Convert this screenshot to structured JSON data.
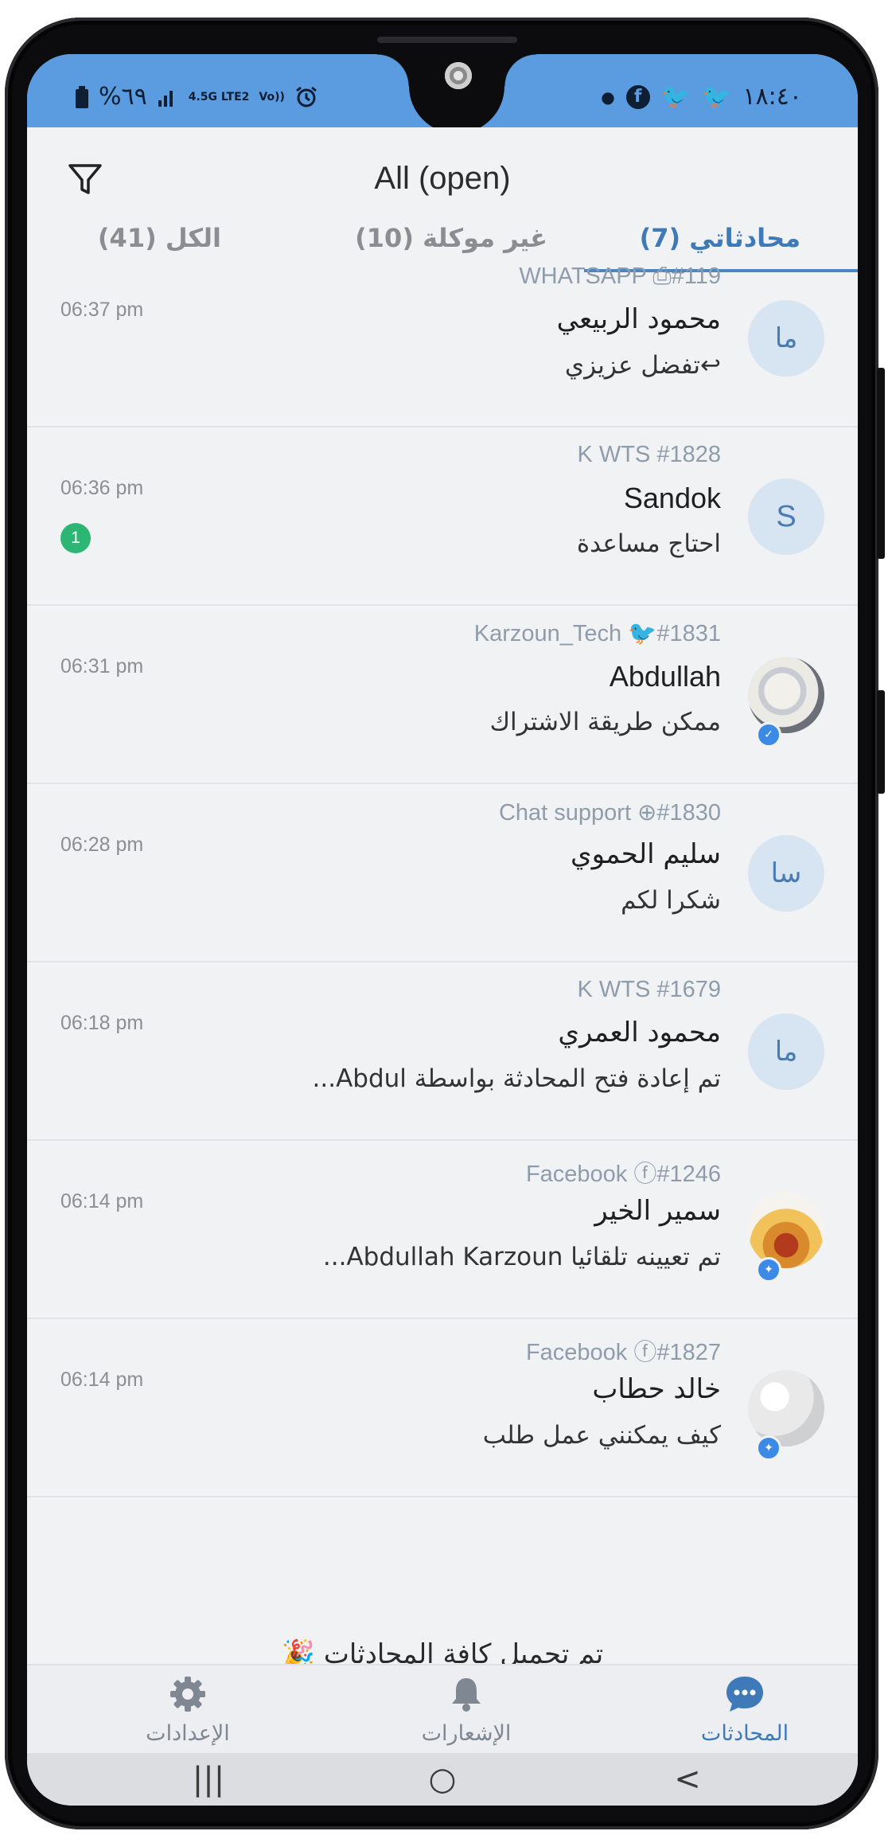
{
  "status_bar": {
    "battery_text": "%٦٩",
    "network_text": "4.5G LTE2",
    "volte": "Vo))",
    "time": "١٨:٤٠",
    "icons": [
      "battery-icon",
      "signal-icon",
      "alarm-icon",
      "dot-icon",
      "facebook-icon",
      "twitter-icon",
      "twitter-icon"
    ]
  },
  "header": {
    "title": "All (open)",
    "filter_icon": "filter-icon"
  },
  "tabs": [
    {
      "label": "محادثاتي (7)",
      "active": true
    },
    {
      "label": "غير موكلة (10)",
      "active": false
    },
    {
      "label": "الكل (41)",
      "active": false
    }
  ],
  "conversations": [
    {
      "meta": "WHATSAPP ⎙#119",
      "name": "محمود الربيعي",
      "message": "↩تفضل عزيزي",
      "time": "06:37 pm",
      "avatar": "ما",
      "unread": null
    },
    {
      "meta": "K WTS #1828",
      "name": "Sandok",
      "message": "احتاج مساعدة",
      "time": "06:36 pm",
      "avatar": "S",
      "unread": "1"
    },
    {
      "meta": "Karzoun_Tech 🐦#1831",
      "name": "Abdullah",
      "message": "ممكن طريقة الاشتراك",
      "time": "06:31 pm",
      "avatar": "",
      "unread": null
    },
    {
      "meta": "Chat support ⊕#1830",
      "name": "سليم الحموي",
      "message": "شكرا لكم",
      "time": "06:28 pm",
      "avatar": "سا",
      "unread": null
    },
    {
      "meta": "K WTS #1679",
      "name": "محمود العمري",
      "message": "تم إعادة فتح المحادثة بواسطة Abdul...",
      "time": "06:18 pm",
      "avatar": "ما",
      "unread": null
    },
    {
      "meta": "Facebook ⓕ#1246",
      "name": "سمير الخير",
      "message": "تم تعيينه تلقائيا Abdullah Karzoun...",
      "time": "06:14 pm",
      "avatar": "",
      "unread": null
    },
    {
      "meta": "Facebook ⓕ#1827",
      "name": "خالد حطاب",
      "message": "كيف يمكنني عمل طلب",
      "time": "06:14 pm",
      "avatar": "",
      "unread": null
    }
  ],
  "loaded_message": "تم تحميل كافة المحادثات 🎉",
  "bottom_nav": [
    {
      "label": "الإعدادات",
      "icon": "gear-icon",
      "active": false
    },
    {
      "label": "الإشعارات",
      "icon": "bell-icon",
      "active": false
    },
    {
      "label": "المحادثات",
      "icon": "chat-icon",
      "active": true
    }
  ],
  "system_nav": {
    "recents": "|||",
    "home": "○",
    "back": "<"
  },
  "colors": {
    "accent": "#3f7ab8",
    "status_bar": "#5b9be0",
    "unread": "#2bb673",
    "background": "#f1f2f4"
  }
}
